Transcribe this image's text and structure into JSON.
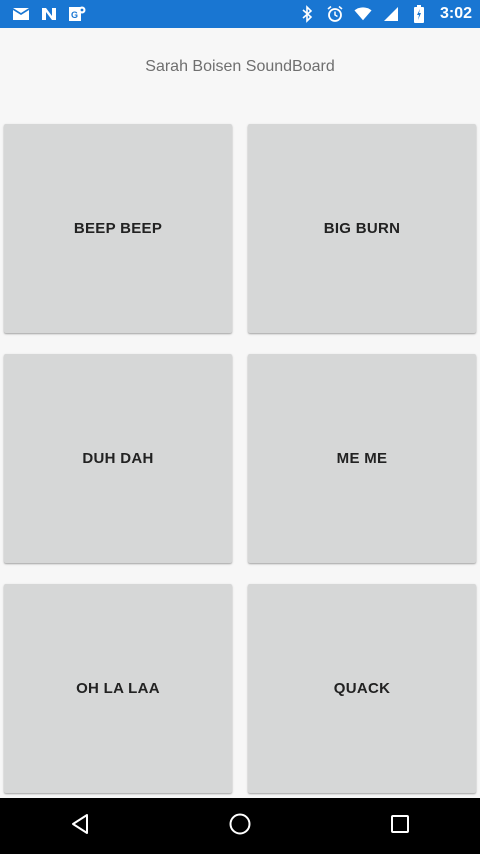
{
  "status_bar": {
    "time": "3:02",
    "left_icons": [
      "mail-icon",
      "n-icon",
      "maps-icon"
    ],
    "right_icons": [
      "bluetooth-icon",
      "alarm-icon",
      "wifi-icon",
      "signal-icon",
      "battery-icon"
    ],
    "background_color": "#1976d2"
  },
  "app": {
    "title": "Sarah Boisen SoundBoard"
  },
  "sounds": [
    {
      "label": "BEEP BEEP"
    },
    {
      "label": "BIG BURN"
    },
    {
      "label": "DUH DAH"
    },
    {
      "label": "ME ME"
    },
    {
      "label": "OH LA LAA"
    },
    {
      "label": "QUACK"
    }
  ],
  "nav_bar": {
    "buttons": [
      "back-icon",
      "home-icon",
      "recents-icon"
    ]
  }
}
